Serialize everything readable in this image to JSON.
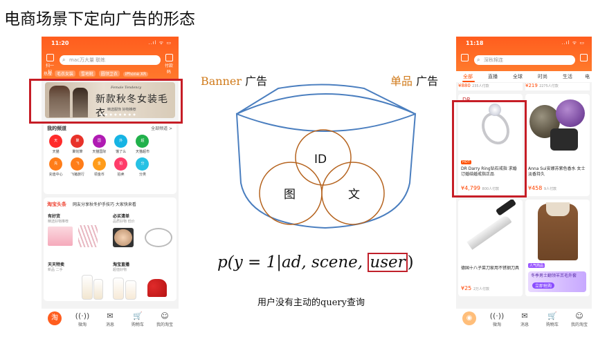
{
  "title": "电商场景下定向广告的形态",
  "left_phone": {
    "time": "11:20",
    "signal": "..ıl ᯤ ▭",
    "search_placeholder": "mac万大量 联练",
    "scan_label": "扫一扫",
    "qr_label": "付款码",
    "hot_label": "热搜:",
    "hot_chips": [
      "毛衣女装",
      "雪地靴",
      "圆领卫衣",
      "iPhone XR"
    ],
    "banner": {
      "brand": "Female Tendency",
      "main_text": "新款秋冬女装毛衣",
      "sub_text": "精选服饰 好物推荐",
      "dots": "● ● ● ● ● ● ● ●"
    },
    "channels_title": "我的频道",
    "channels_link": "全部频道 >",
    "channels": [
      {
        "icon": "天",
        "label": "天猫",
        "color": "#ff2b2b"
      },
      {
        "icon": "聚",
        "label": "聚划算",
        "color": "#e8322a"
      },
      {
        "icon": "国",
        "label": "天猫国际",
        "color": "#b01bb3"
      },
      {
        "icon": "外",
        "label": "饿了么",
        "color": "#16b4e4"
      },
      {
        "icon": "超",
        "label": "天猫超市",
        "color": "#21b14b"
      },
      {
        "icon": "",
        "label": "",
        "color": "#ffffff"
      },
      {
        "icon": "充",
        "label": "充值中心",
        "color": "#ff7d19"
      },
      {
        "icon": "飞",
        "label": "飞猪旅行",
        "color": "#ff7d19"
      },
      {
        "icon": "金",
        "label": "领金币",
        "color": "#ff9c1a"
      },
      {
        "icon": "拍",
        "label": "拍卖",
        "color": "#ff3c6a"
      },
      {
        "icon": "分",
        "label": "分类",
        "color": "#26c1e4"
      },
      {
        "icon": "",
        "label": "",
        "color": "#ffffff"
      }
    ],
    "feed": {
      "source": "淘宝头条",
      "headline": "网友分享秋冬护手技巧 大家快来看",
      "cells": [
        {
          "title": "有好货",
          "sub": "精选好物推荐"
        },
        {
          "title": "必买清单",
          "sub": "品质好物 低价"
        },
        {
          "title": "天天特卖",
          "sub": "新品 二手"
        },
        {
          "title": "淘宝直播",
          "sub": "超值好物"
        }
      ]
    },
    "tabs": [
      {
        "icon": "淘",
        "label": ""
      },
      {
        "icon": "((·))",
        "label": "微淘"
      },
      {
        "icon": "✉",
        "label": "消息"
      },
      {
        "icon": "🛒",
        "label": "购物车"
      },
      {
        "icon": "☺",
        "label": "我的淘宝"
      }
    ]
  },
  "right_phone": {
    "time": "11:18",
    "signal": "..ıl ᯤ ▭",
    "search_placeholder": "深秋棉连",
    "categories": [
      "全部",
      "直播",
      "全球",
      "时尚",
      "生活",
      "电"
    ],
    "price_strip": [
      {
        "price": "¥880",
        "note": "235人付款"
      },
      {
        "price": "¥219",
        "note": "2275人付款"
      }
    ],
    "products": [
      {
        "name": "DR Darry Ring钻石戒指 求婚订婚结婚戒指正品",
        "price": "¥4,799",
        "note": "800人付款",
        "tag": "HOT"
      },
      {
        "name": "Anna Sui安娜苏紫色香水 女士淡香持久",
        "price": "¥458",
        "note": "9人付款"
      },
      {
        "name": "德国十八子菜刀家用不锈钢刀具",
        "price": "¥25",
        "note": "2万人付款"
      },
      {
        "name": "冬季男士翻领羊羔毛外套",
        "price": "立即抢购",
        "note": "人气商品"
      }
    ],
    "tabs": [
      {
        "icon": "◉",
        "label": ""
      },
      {
        "icon": "((·))",
        "label": "微淘"
      },
      {
        "icon": "✉",
        "label": "消息"
      },
      {
        "icon": "🛒",
        "label": "购物车"
      },
      {
        "icon": "☺",
        "label": "我的淘宝"
      }
    ]
  },
  "diagram": {
    "banner_label_en": "Banner",
    "banner_label_cn": "广告",
    "item_label_cn": "单品",
    "item_label_suffix": "广告",
    "venn": {
      "top": "ID",
      "left": "图",
      "right": "文"
    },
    "formula": {
      "prefix": "p(y = 1|ad, scene, ",
      "boxed": "user",
      "suffix": ")"
    },
    "caption": "用户没有主动的query查询"
  },
  "colors": {
    "taobao_orange": "#ff5d1e",
    "highlight_red": "#c61d26",
    "diagram_blue": "#4a7ebf",
    "venn_brown": "#b5631e"
  }
}
